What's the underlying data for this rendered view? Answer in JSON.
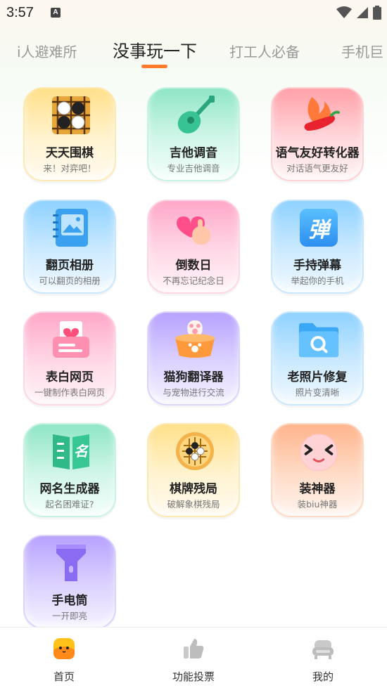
{
  "status": {
    "time": "3:57",
    "notif_letter": "A"
  },
  "tabs": [
    {
      "label": "i人避难所"
    },
    {
      "label": "没事玩一下"
    },
    {
      "label": "打工人必备"
    },
    {
      "label": "手机巨"
    }
  ],
  "cards": [
    {
      "title": "天天围棋",
      "sub": "来！对弈吧！",
      "icon": "go-board-icon"
    },
    {
      "title": "吉他调音",
      "sub": "专业吉他调音",
      "icon": "guitar-icon"
    },
    {
      "title": "语气友好转化器",
      "sub": "对话语气更友好",
      "icon": "chili-pepper-icon"
    },
    {
      "title": "翻页相册",
      "sub": "可以翻页的相册",
      "icon": "photo-album-icon"
    },
    {
      "title": "倒数日",
      "sub": "不再忘记纪念日",
      "icon": "heart-hand-icon"
    },
    {
      "title": "手持弹幕",
      "sub": "举起你的手机",
      "icon": "danmaku-icon"
    },
    {
      "title": "表白网页",
      "sub": "一键制作表白网页",
      "icon": "love-letter-icon"
    },
    {
      "title": "猫狗翻译器",
      "sub": "与宠物进行交流",
      "icon": "pet-bowl-icon"
    },
    {
      "title": "老照片修复",
      "sub": "照片变清晰",
      "icon": "folder-search-icon"
    },
    {
      "title": "网名生成器",
      "sub": "起名困难证?",
      "icon": "name-book-icon"
    },
    {
      "title": "棋牌残局",
      "sub": "破解象棋残局",
      "icon": "chess-board-icon"
    },
    {
      "title": "装神器",
      "sub": "装biu神器",
      "icon": "cool-face-icon"
    },
    {
      "title": "手电筒",
      "sub": "一开即亮",
      "icon": "flashlight-icon"
    }
  ],
  "icons": {
    "danmaku_glyph": "弹",
    "name_glyph": "名"
  },
  "nav": [
    {
      "label": "首页",
      "icon": "home-face-icon"
    },
    {
      "label": "功能投票",
      "icon": "thumbs-up-icon"
    },
    {
      "label": "我的",
      "icon": "profile-chair-icon"
    }
  ],
  "colors": {
    "accent": "#ff7a2a"
  }
}
